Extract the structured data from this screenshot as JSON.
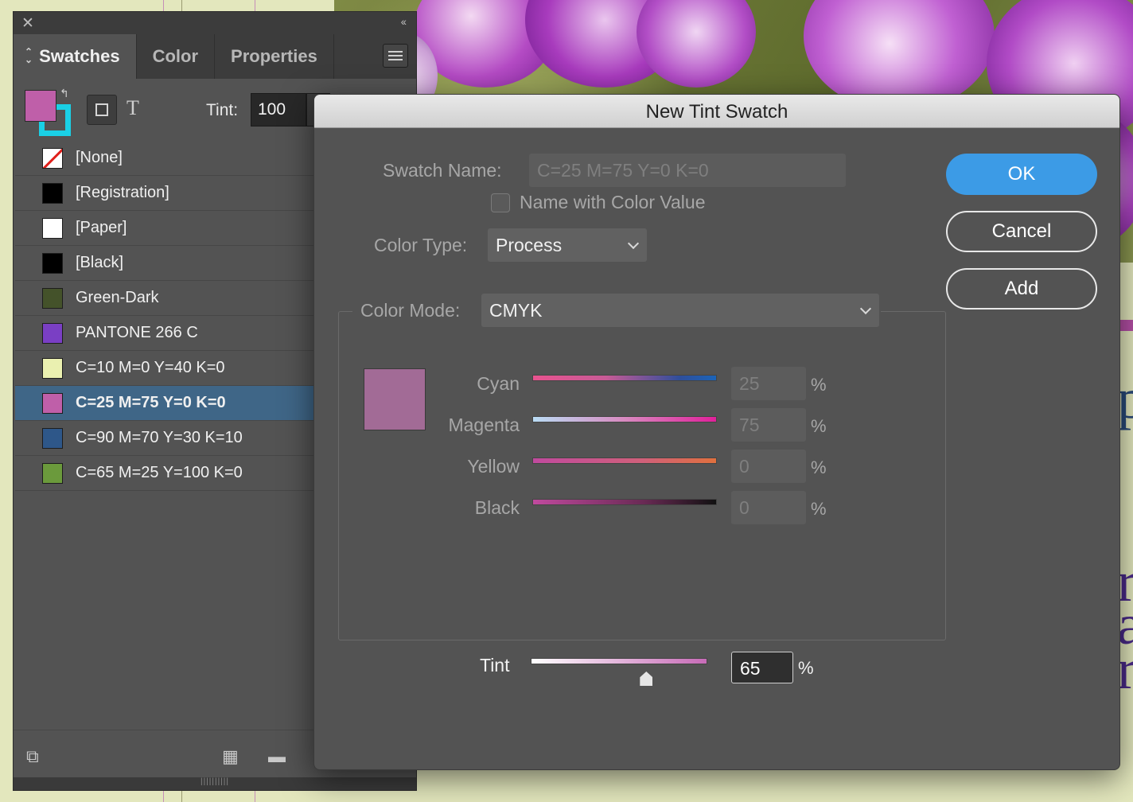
{
  "panel": {
    "tabs": [
      {
        "label": "Swatches"
      },
      {
        "label": "Color"
      },
      {
        "label": "Properties"
      }
    ],
    "tint_label": "Tint:",
    "tint_value": "100",
    "fill_color": "#bf5fa9",
    "stroke_color": "#1ad0e6",
    "text_icon": "T",
    "swatches": [
      {
        "name": "[None]",
        "color": "none"
      },
      {
        "name": "[Registration]",
        "color": "#000000"
      },
      {
        "name": "[Paper]",
        "color": "#ffffff"
      },
      {
        "name": "[Black]",
        "color": "#000000"
      },
      {
        "name": "Green-Dark",
        "color": "#44522a"
      },
      {
        "name": "PANTONE 266 C",
        "color": "#7a3fc4"
      },
      {
        "name": "C=10 M=0 Y=40 K=0",
        "color": "#eaf0b0"
      },
      {
        "name": "C=25 M=75 Y=0 K=0",
        "color": "#bf5fa9",
        "selected": true
      },
      {
        "name": "C=90 M=70 Y=30 K=10",
        "color": "#2e5789"
      },
      {
        "name": "C=65 M=25 Y=100 K=0",
        "color": "#6b9a3c"
      }
    ]
  },
  "dialog": {
    "title": "New Tint Swatch",
    "swatch_name_label": "Swatch Name:",
    "swatch_name_value": "C=25 M=75 Y=0 K=0",
    "name_with_color_value_label": "Name with Color Value",
    "color_type_label": "Color Type:",
    "color_type_value": "Process",
    "color_mode_label": "Color Mode:",
    "color_mode_value": "CMYK",
    "preview_color": "#a26b96",
    "channels": [
      {
        "label": "Cyan",
        "value": "25",
        "gradient": "linear-gradient(90deg,#e8538f,#c75b96 40%,#2f4e9a 80%,#1b64b8)"
      },
      {
        "label": "Magenta",
        "value": "75",
        "gradient": "linear-gradient(90deg,#b9dcf4,#d88ac0 50%,#e0219a)"
      },
      {
        "label": "Yellow",
        "value": "0",
        "gradient": "linear-gradient(90deg,#c04a9e,#d0607a 60%,#e0703e)"
      },
      {
        "label": "Black",
        "value": "0",
        "gradient": "linear-gradient(90deg,#c04a9e,#6a2a55 60%,#111111)"
      }
    ],
    "percent_sign": "%",
    "tint_label": "Tint",
    "tint_value": "65",
    "tint_fraction": 0.65,
    "buttons": {
      "ok": "OK",
      "cancel": "Cancel",
      "add": "Add"
    }
  }
}
